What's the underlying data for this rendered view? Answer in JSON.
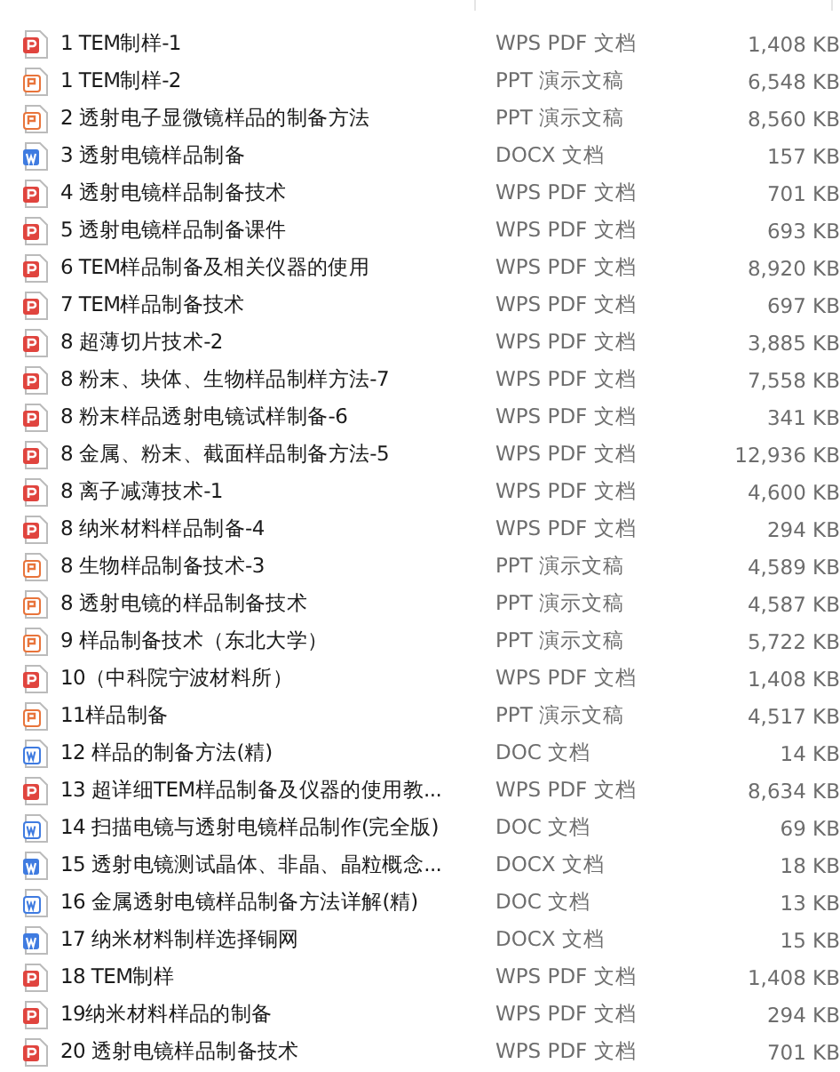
{
  "rows": [
    {
      "kind": "pdf",
      "name": "1 TEM制样-1",
      "type": "WPS PDF 文档",
      "size": "1,408 KB"
    },
    {
      "kind": "ppt",
      "name": "1 TEM制样-2",
      "type": "PPT 演示文稿",
      "size": "6,548 KB"
    },
    {
      "kind": "ppt",
      "name": "2 透射电子显微镜样品的制备方法",
      "type": "PPT 演示文稿",
      "size": "8,560 KB"
    },
    {
      "kind": "docx",
      "name": "3 透射电镜样品制备",
      "type": "DOCX 文档",
      "size": "157 KB"
    },
    {
      "kind": "pdf",
      "name": "4 透射电镜样品制备技术",
      "type": "WPS PDF 文档",
      "size": "701 KB"
    },
    {
      "kind": "pdf",
      "name": "5 透射电镜样品制备课件",
      "type": "WPS PDF 文档",
      "size": "693 KB"
    },
    {
      "kind": "pdf",
      "name": "6 TEM样品制备及相关仪器的使用",
      "type": "WPS PDF 文档",
      "size": "8,920 KB"
    },
    {
      "kind": "pdf",
      "name": "7 TEM样品制备技术",
      "type": "WPS PDF 文档",
      "size": "697 KB"
    },
    {
      "kind": "pdf",
      "name": "8 超薄切片技术-2",
      "type": "WPS PDF 文档",
      "size": "3,885 KB"
    },
    {
      "kind": "pdf",
      "name": "8 粉末、块体、生物样品制样方法-7",
      "type": "WPS PDF 文档",
      "size": "7,558 KB"
    },
    {
      "kind": "pdf",
      "name": "8 粉末样品透射电镜试样制备-6",
      "type": "WPS PDF 文档",
      "size": "341 KB"
    },
    {
      "kind": "pdf",
      "name": "8 金属、粉末、截面样品制备方法-5",
      "type": "WPS PDF 文档",
      "size": "12,936 KB"
    },
    {
      "kind": "pdf",
      "name": "8 离子减薄技术-1",
      "type": "WPS PDF 文档",
      "size": "4,600 KB"
    },
    {
      "kind": "pdf",
      "name": "8 纳米材料样品制备-4",
      "type": "WPS PDF 文档",
      "size": "294 KB"
    },
    {
      "kind": "ppt",
      "name": "8 生物样品制备技术-3",
      "type": "PPT 演示文稿",
      "size": "4,589 KB"
    },
    {
      "kind": "ppt",
      "name": "8 透射电镜的样品制备技术",
      "type": "PPT 演示文稿",
      "size": "4,587 KB"
    },
    {
      "kind": "ppt",
      "name": "9 样品制备技术（东北大学）",
      "type": "PPT 演示文稿",
      "size": "5,722 KB"
    },
    {
      "kind": "pdf",
      "name": "10（中科院宁波材料所）",
      "type": "WPS PDF 文档",
      "size": "1,408 KB"
    },
    {
      "kind": "ppt",
      "name": "11样品制备",
      "type": "PPT 演示文稿",
      "size": "4,517 KB"
    },
    {
      "kind": "doc",
      "name": "12 样品的制备方法(精)",
      "type": "DOC 文档",
      "size": "14 KB"
    },
    {
      "kind": "pdf",
      "name": "13 超详细TEM样品制备及仪器的使用教...",
      "type": "WPS PDF 文档",
      "size": "8,634 KB"
    },
    {
      "kind": "doc",
      "name": "14 扫描电镜与透射电镜样品制作(完全版)",
      "type": "DOC 文档",
      "size": "69 KB"
    },
    {
      "kind": "docx",
      "name": "15 透射电镜测试晶体、非晶、晶粒概念...",
      "type": "DOCX 文档",
      "size": "18 KB"
    },
    {
      "kind": "doc",
      "name": "16 金属透射电镜样品制备方法详解(精)",
      "type": "DOC 文档",
      "size": "13 KB"
    },
    {
      "kind": "docx",
      "name": "17 纳米材料制样选择铜网",
      "type": "DOCX 文档",
      "size": "15 KB"
    },
    {
      "kind": "pdf",
      "name": "18 TEM制样",
      "type": "WPS PDF 文档",
      "size": "1,408 KB"
    },
    {
      "kind": "pdf",
      "name": "19纳米材料样品的制备",
      "type": "WPS PDF 文档",
      "size": "294 KB"
    },
    {
      "kind": "pdf",
      "name": "20 透射电镜样品制备技术",
      "type": "WPS PDF 文档",
      "size": "701 KB"
    }
  ]
}
